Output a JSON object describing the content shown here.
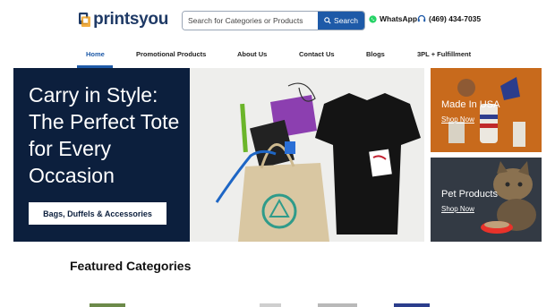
{
  "header": {
    "logo_text": "printsyou",
    "search_placeholder": "Search for Categories or Products",
    "search_button": "Search",
    "whatsapp_label": "WhatsApp",
    "phone": "(469) 434-7035"
  },
  "nav": {
    "items": [
      {
        "label": "Home",
        "active": true
      },
      {
        "label": "Promotional Products"
      },
      {
        "label": "About Us"
      },
      {
        "label": "Contact Us"
      },
      {
        "label": "Blogs"
      },
      {
        "label": "3PL + Fulfillment"
      }
    ]
  },
  "hero": {
    "title": "Carry in Style: The Perfect Tote for Every Occasion",
    "button_label": "Bags, Duffels & Accessories"
  },
  "promos": [
    {
      "title": "Made In USA",
      "link": "Shop Now"
    },
    {
      "title": "Pet Products",
      "link": "Shop Now"
    }
  ],
  "featured": {
    "title": "Featured Categories"
  },
  "colors": {
    "brand_blue": "#1e5aa8",
    "hero_navy": "#0c1f3d",
    "logo_orange": "#f0a020"
  }
}
